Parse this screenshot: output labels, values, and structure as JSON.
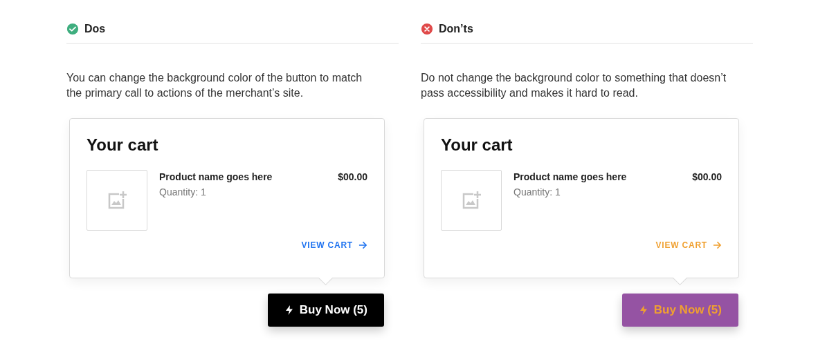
{
  "panels": [
    {
      "kind": "do",
      "heading": "Dos",
      "description": "You can change the background color of the button to match the primary call to actions of the merchant’s site.",
      "cart": {
        "title": "Your cart",
        "product_name": "Product name goes here",
        "quantity": "Quantity: 1",
        "price": "$00.00",
        "link": {
          "label": "VIEW CART",
          "color": "#1f73f0"
        }
      },
      "button": {
        "label": "Buy Now (5)",
        "color": "#000000",
        "foreground": {
          "color": "#ffffff"
        }
      }
    },
    {
      "kind": "dont",
      "heading": "Don’ts",
      "description": "Do not change the background color to something that doesn’t pass accessibility and makes it hard to read.",
      "cart": {
        "title": "Your cart",
        "product_name": "Product name goes here",
        "quantity": "Quantity: 1",
        "price": "$00.00",
        "link": {
          "label": "VIEW CART",
          "color": "#f0a030"
        }
      },
      "button": {
        "label": "Buy Now (5)",
        "color": "#9553a3",
        "foreground": {
          "color": "#f0a030"
        }
      }
    }
  ]
}
